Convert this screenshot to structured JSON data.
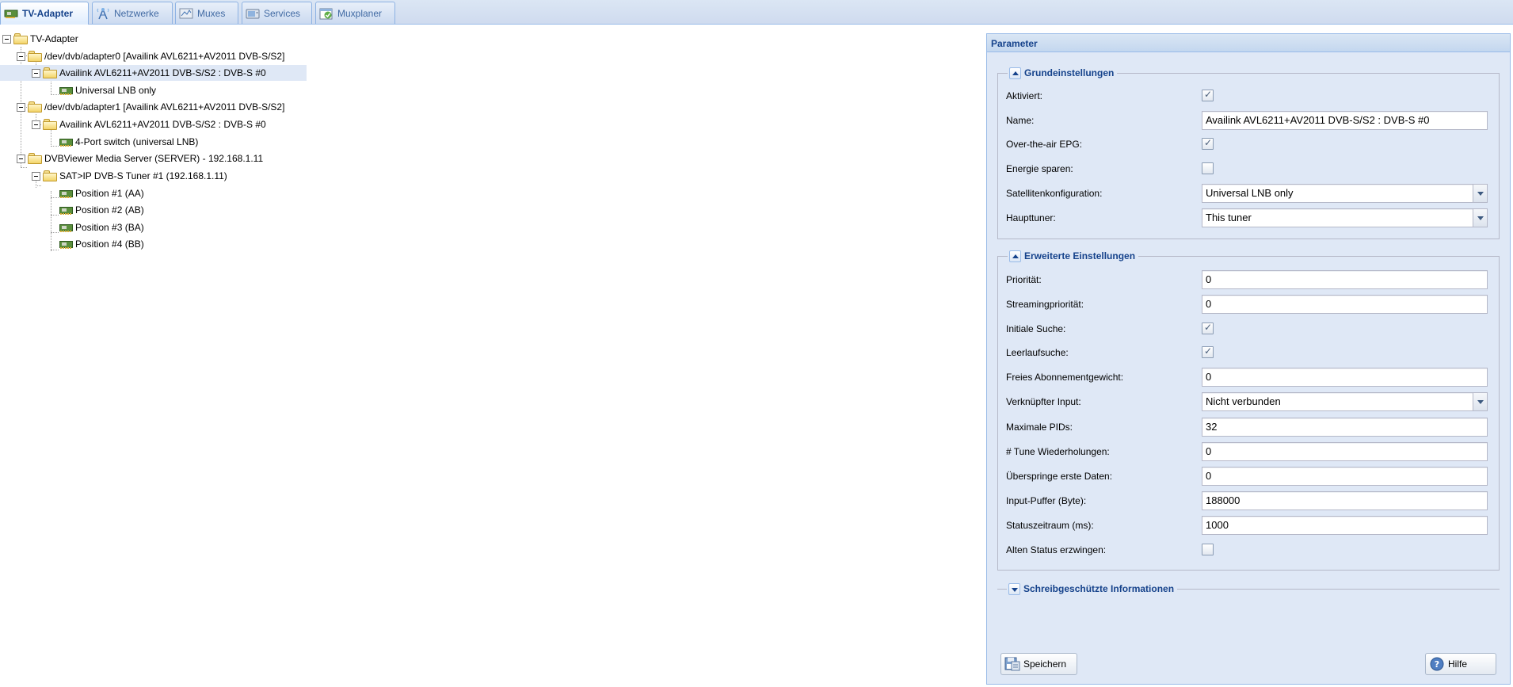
{
  "tabs": [
    {
      "label": "TV-Adapter",
      "icon": "tv-card-icon",
      "active": true
    },
    {
      "label": "Netzwerke",
      "icon": "antenna-icon",
      "active": false
    },
    {
      "label": "Muxes",
      "icon": "muxes-icon",
      "active": false
    },
    {
      "label": "Services",
      "icon": "services-icon",
      "active": false
    },
    {
      "label": "Muxplaner",
      "icon": "muxplaner-icon",
      "active": false
    }
  ],
  "tree": {
    "nodes": [
      {
        "label": "TV-Adapter",
        "type": "folder",
        "selected": false
      },
      {
        "label": "/dev/dvb/adapter0 [Availink AVL6211+AV2011 DVB-S/S2]",
        "type": "folder",
        "selected": false
      },
      {
        "label": "Availink AVL6211+AV2011 DVB-S/S2 : DVB-S #0",
        "type": "folder",
        "selected": true
      },
      {
        "label": "Universal LNB only",
        "type": "card",
        "selected": false
      },
      {
        "label": "/dev/dvb/adapter1 [Availink AVL6211+AV2011 DVB-S/S2]",
        "type": "folder",
        "selected": false
      },
      {
        "label": "Availink AVL6211+AV2011 DVB-S/S2 : DVB-S #0",
        "type": "folder",
        "selected": false
      },
      {
        "label": "4-Port switch (universal LNB)",
        "type": "card",
        "selected": false
      },
      {
        "label": "DVBViewer Media Server (SERVER) - 192.168.1.11",
        "type": "folder",
        "selected": false
      },
      {
        "label": "SAT>IP DVB-S Tuner #1 (192.168.1.11)",
        "type": "folder",
        "selected": false
      },
      {
        "label": "Position #1 (AA)",
        "type": "card",
        "selected": false
      },
      {
        "label": "Position #2 (AB)",
        "type": "card",
        "selected": false
      },
      {
        "label": "Position #3 (BA)",
        "type": "card",
        "selected": false
      },
      {
        "label": "Position #4 (BB)",
        "type": "card",
        "selected": false
      }
    ]
  },
  "panel": {
    "title": "Parameter",
    "basic": {
      "legend": "Grundeinstellungen",
      "fields": [
        {
          "label": "Aktiviert:",
          "type": "checkbox",
          "checked": true
        },
        {
          "label": "Name:",
          "type": "text",
          "value": "Availink AVL6211+AV2011 DVB-S/S2 : DVB-S #0"
        },
        {
          "label": "Over-the-air EPG:",
          "type": "checkbox",
          "checked": true
        },
        {
          "label": "Energie sparen:",
          "type": "checkbox",
          "checked": false
        },
        {
          "label": "Satellitenkonfiguration:",
          "type": "select",
          "value": "Universal LNB only"
        },
        {
          "label": "Haupttuner:",
          "type": "select",
          "value": "This tuner"
        }
      ]
    },
    "advanced": {
      "legend": "Erweiterte Einstellungen",
      "fields": [
        {
          "label": "Priorität:",
          "type": "text",
          "value": "0"
        },
        {
          "label": "Streamingpriorität:",
          "type": "text",
          "value": "0"
        },
        {
          "label": "Initiale Suche:",
          "type": "checkbox",
          "checked": true
        },
        {
          "label": "Leerlaufsuche:",
          "type": "checkbox",
          "checked": true
        },
        {
          "label": "Freies Abonnementgewicht:",
          "type": "text",
          "value": "0"
        },
        {
          "label": "Verknüpfter Input:",
          "type": "select",
          "value": "Nicht verbunden"
        },
        {
          "label": "Maximale PIDs:",
          "type": "text",
          "value": "32"
        },
        {
          "label": "# Tune Wiederholungen:",
          "type": "text",
          "value": "0"
        },
        {
          "label": "Überspringe erste Daten:",
          "type": "text",
          "value": "0"
        },
        {
          "label": "Input-Puffer (Byte):",
          "type": "text",
          "value": "188000"
        },
        {
          "label": "Statuszeitraum (ms):",
          "type": "text",
          "value": "1000"
        },
        {
          "label": "Alten Status erzwingen:",
          "type": "checkbox",
          "checked": false
        }
      ]
    },
    "readonly": {
      "legend": "Schreibgeschützte Informationen"
    },
    "buttons": {
      "save": "Speichern",
      "help": "Hilfe"
    }
  }
}
